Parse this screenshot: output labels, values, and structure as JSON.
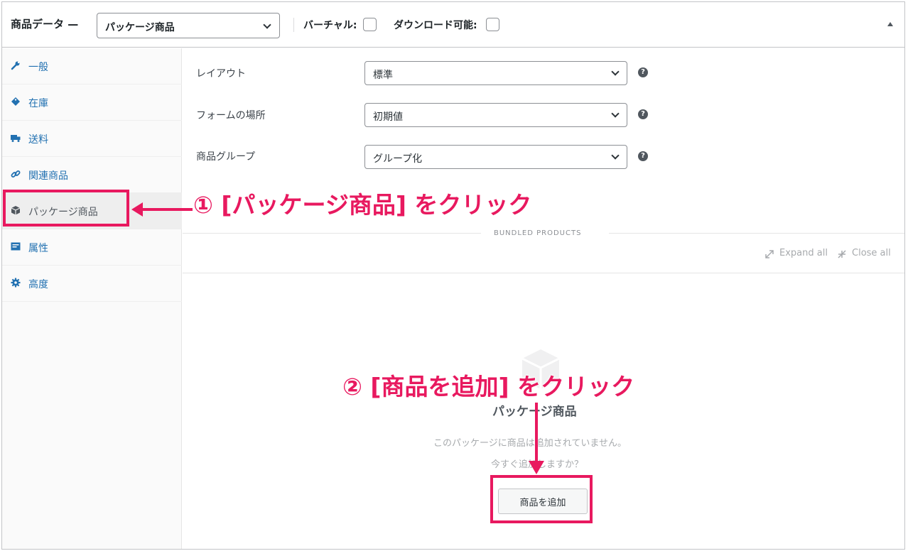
{
  "header": {
    "title": "商品データ —",
    "product_type": "パッケージ商品",
    "virtual_label": "バーチャル:",
    "downloadable_label": "ダウンロード可能:"
  },
  "sidebar": {
    "items": [
      {
        "label": "一般",
        "icon": "wrench-icon"
      },
      {
        "label": "在庫",
        "icon": "tag-icon"
      },
      {
        "label": "送料",
        "icon": "truck-icon"
      },
      {
        "label": "関連商品",
        "icon": "link-icon"
      },
      {
        "label": "パッケージ商品",
        "icon": "box-icon",
        "active": true
      },
      {
        "label": "属性",
        "icon": "list-icon"
      },
      {
        "label": "高度",
        "icon": "gear-icon"
      }
    ]
  },
  "main": {
    "fields": [
      {
        "label": "レイアウト",
        "value": "標準"
      },
      {
        "label": "フォームの場所",
        "value": "初期値"
      },
      {
        "label": "商品グループ",
        "value": "グループ化"
      }
    ],
    "help_glyph": "?",
    "bundled_title": "BUNDLED PRODUCTS",
    "expand_all": "Expand all",
    "close_all": "Close all",
    "empty_title": "パッケージ商品",
    "empty_text": "このパッケージに商品は追加されていません。",
    "empty_question": "今すぐ追加しますか？",
    "add_button": "商品を追加"
  },
  "annotations": {
    "step1": "① [パッケージ商品] をクリック",
    "step2": "② [商品を追加] をクリック",
    "color": "#e8195f"
  },
  "colors": {
    "link": "#2271b1",
    "accent": "#e8195f"
  }
}
